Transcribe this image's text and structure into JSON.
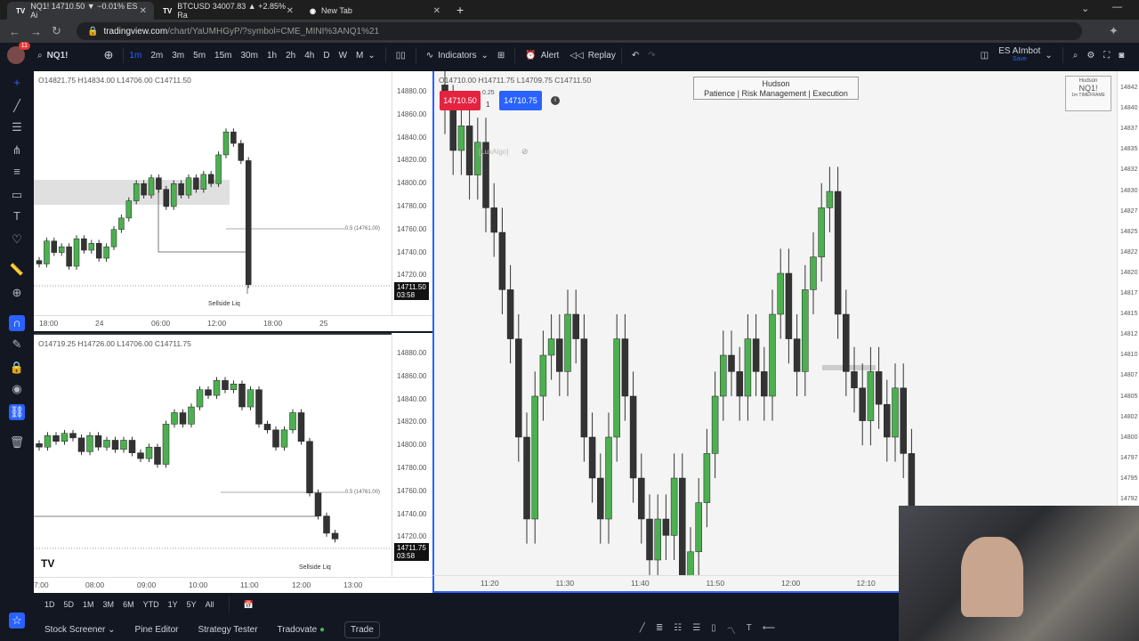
{
  "browser": {
    "tabs": [
      {
        "title": "NQ1! 14710.50 ▼ −0.01% ES Ai",
        "active": true
      },
      {
        "title": "BTCUSD 34007.83 ▲ +2.85% Ra"
      },
      {
        "title": "New Tab"
      }
    ],
    "url_host": "tradingview.com",
    "url_path": "/chart/YaUMHGyP/?symbol=CME_MINI%3ANQ1%21"
  },
  "toolbar": {
    "notif_count": "11",
    "symbol": "NQ1!",
    "intervals": [
      "1m",
      "2m",
      "3m",
      "5m",
      "15m",
      "30m",
      "1h",
      "2h",
      "4h",
      "D",
      "W",
      "M"
    ],
    "active_interval": "1m",
    "indicators": "Indicators",
    "alert": "Alert",
    "replay": "Replay",
    "layout_name": "ES AImbot",
    "layout_status": "Save"
  },
  "main": {
    "ohlc": "O14710.00 H14711.75 L14709.75 C14711.50",
    "sell": "14710.50",
    "buy": "14710.75",
    "spread": "0.25",
    "qty": "1",
    "indicator": "[LuxAlgo]",
    "banner_title": "Hudson",
    "banner_text": "Patience | Risk Management | Execution",
    "badge_top": "Hudson",
    "badge_symbol": "NQ1!",
    "badge_tf": "1m TIMEFRAME",
    "yaxis": [
      "14842",
      "14840",
      "14837",
      "14835",
      "14832",
      "14830",
      "14827",
      "14825",
      "14822",
      "14820",
      "14817",
      "14815",
      "14812",
      "14810",
      "14807",
      "14805",
      "14802",
      "14800",
      "14797",
      "14795",
      "14792"
    ],
    "xaxis": [
      "11:20",
      "11:30",
      "11:40",
      "11:50",
      "12:00",
      "12:10"
    ],
    "closes": [
      14840,
      14835,
      14838,
      14832,
      14836,
      14828,
      14825,
      14818,
      14812,
      14800,
      14790,
      14805,
      14810,
      14812,
      14808,
      14815,
      14812,
      14800,
      14795,
      14790,
      14800,
      14812,
      14805,
      14795,
      14790,
      14785,
      14790,
      14788,
      14795,
      14783,
      14786,
      14792,
      14798,
      14805,
      14810,
      14808,
      14805,
      14812,
      14808,
      14805,
      14815,
      14820,
      14812,
      14808,
      14818,
      14822,
      14828,
      14830,
      14815,
      14808,
      14806,
      14802,
      14808,
      14804,
      14800,
      14806,
      14798,
      14790
    ]
  },
  "top": {
    "ohlc": "O14821.75 H14834.00 L14706.00 C14711.50",
    "yaxis": [
      "14880.00",
      "14860.00",
      "14840.00",
      "14820.00",
      "14800.00",
      "14780.00",
      "14760.00",
      "14740.00",
      "14720.00"
    ],
    "xaxis": [
      "18:00",
      "24",
      "06:00",
      "12:00",
      "18:00",
      "25"
    ],
    "price": "14711.50",
    "countdown": "03:58",
    "fib": "0.5 (14761.00)",
    "label": "Sellside Liq",
    "closes": [
      14730,
      14750,
      14740,
      14745,
      14728,
      14752,
      14742,
      14748,
      14735,
      14745,
      14760,
      14770,
      14785,
      14800,
      14790,
      14805,
      14795,
      14780,
      14800,
      14790,
      14805,
      14795,
      14808,
      14800,
      14825,
      14845,
      14835,
      14820,
      14712
    ]
  },
  "bottom": {
    "ohlc": "O14719.25 H14726.00 L14706.00 C14711.75",
    "yaxis": [
      "14880.00",
      "14860.00",
      "14840.00",
      "14820.00",
      "14800.00",
      "14780.00",
      "14760.00",
      "14740.00",
      "14720.00"
    ],
    "xaxis": [
      "7:00",
      "08:00",
      "09:00",
      "10:00",
      "11:00",
      "12:00",
      "13:00"
    ],
    "price": "14711.75",
    "countdown": "03:58",
    "fib": "0.5 (14761.00)",
    "label": "Sellside Liq",
    "closes": [
      14800,
      14810,
      14805,
      14812,
      14808,
      14796,
      14810,
      14800,
      14806,
      14798,
      14806,
      14795,
      14790,
      14800,
      14785,
      14820,
      14830,
      14820,
      14835,
      14850,
      14845,
      14858,
      14850,
      14855,
      14835,
      14850,
      14820,
      14815,
      14800,
      14815,
      14830,
      14805,
      14760,
      14740,
      14725,
      14720
    ]
  },
  "ranges": [
    "1D",
    "5D",
    "1M",
    "3M",
    "6M",
    "YTD",
    "1Y",
    "5Y",
    "All"
  ],
  "bottom_panel": {
    "screener": "Stock Screener",
    "pine": "Pine Editor",
    "tester": "Strategy Tester",
    "broker": "Tradovate",
    "trade": "Trade"
  },
  "colors": {
    "up": "#4caf50",
    "down": "#333333",
    "sell": "#e5223f",
    "buy": "#2962ff",
    "accent": "#2962ff"
  }
}
